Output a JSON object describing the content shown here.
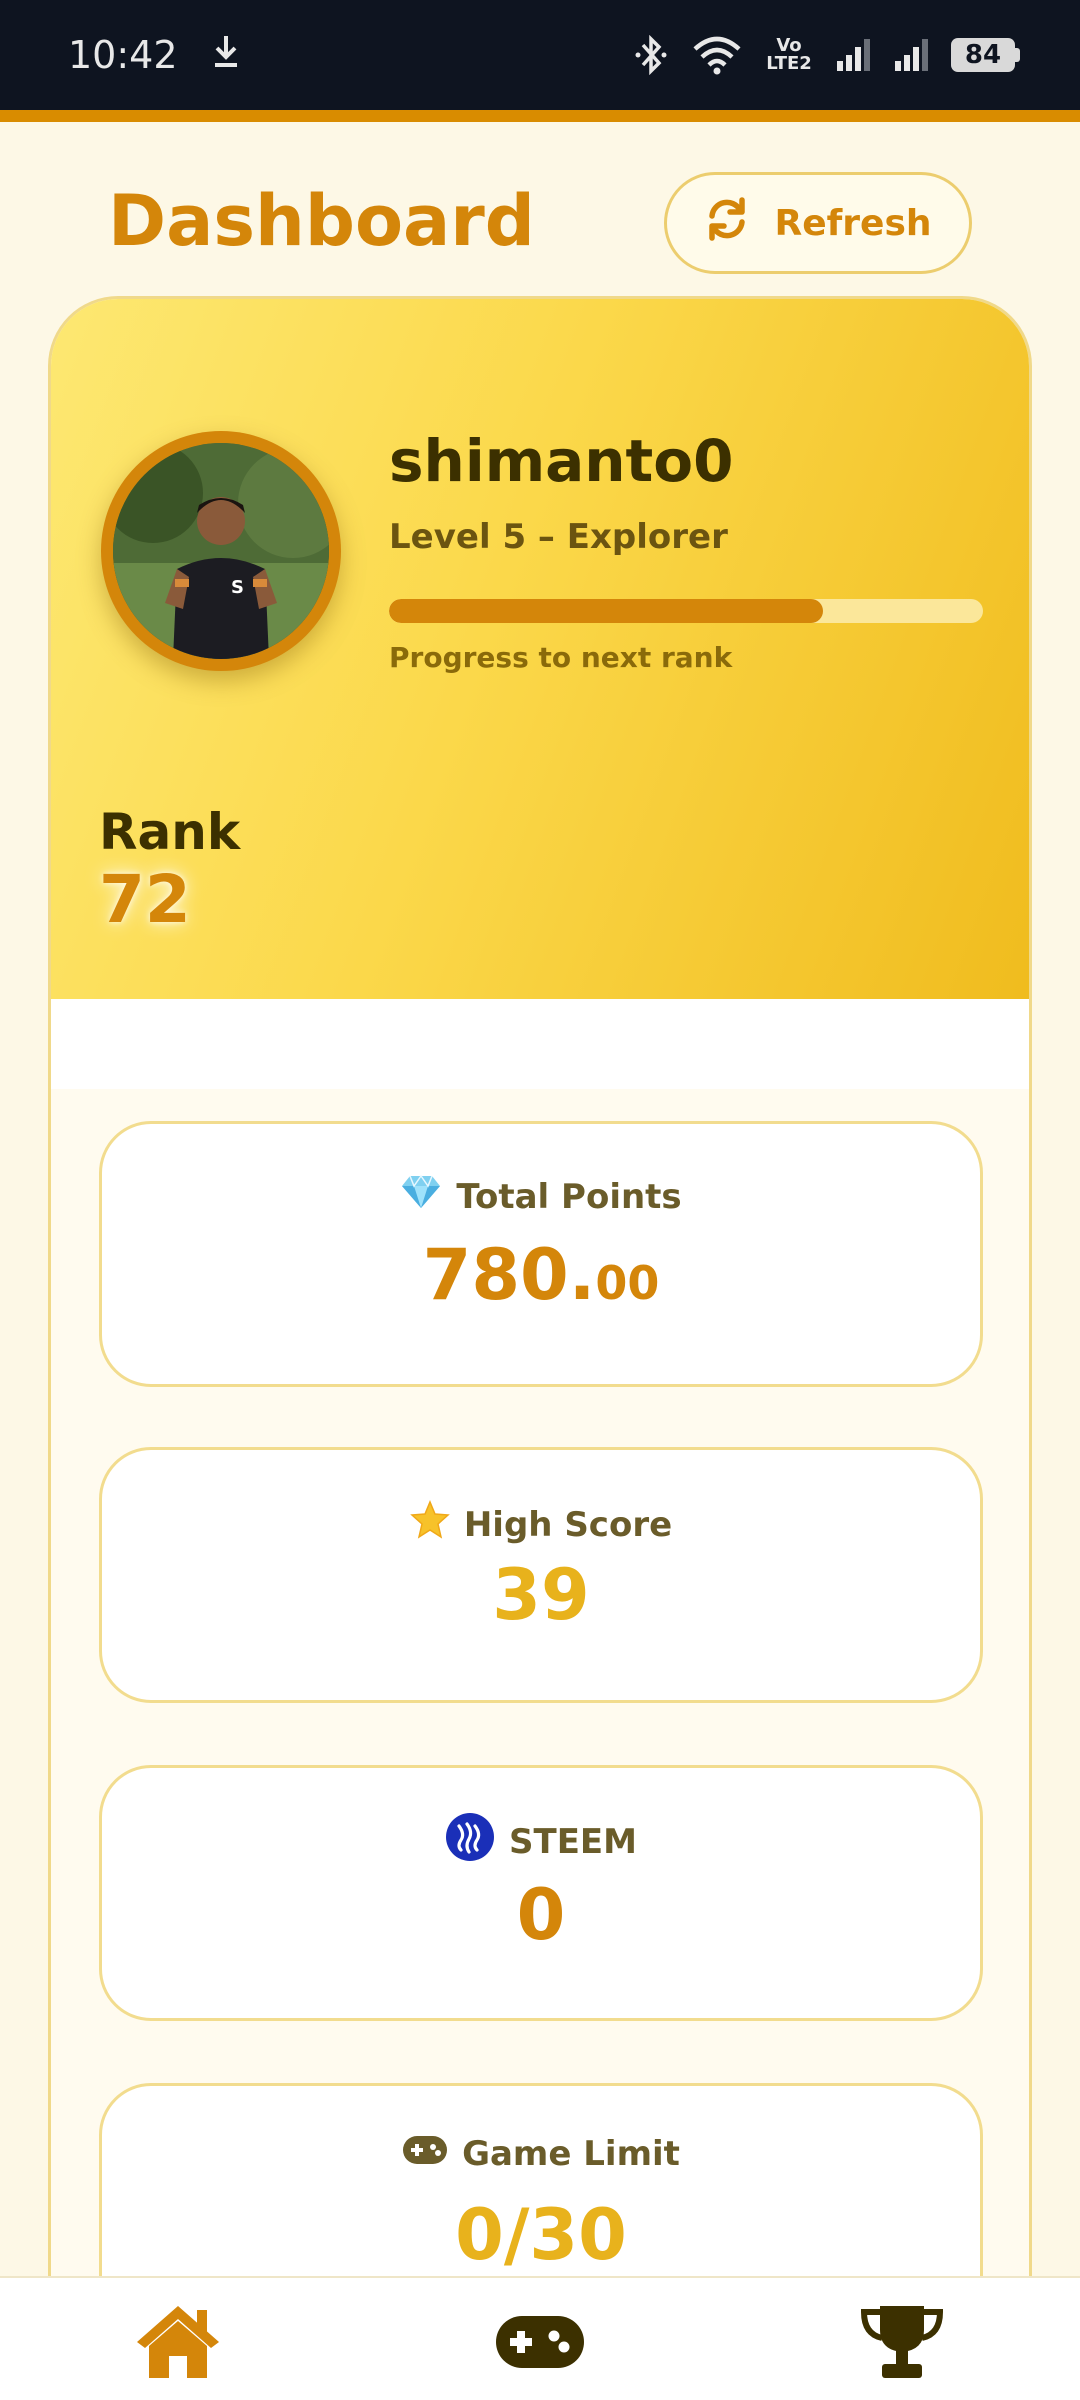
{
  "status_bar": {
    "time": "10:42",
    "network_label": "Vo LTE2",
    "battery": "84"
  },
  "header": {
    "title": "Dashboard",
    "refresh_label": "Refresh"
  },
  "profile": {
    "username": "shimanto0",
    "level": "Level 5 – Explorer",
    "progress_fraction": 0.73,
    "progress_caption": "Progress to next rank",
    "rank_label": "Rank",
    "rank_value": "72"
  },
  "stats": {
    "total_points": {
      "label": "Total Points",
      "value_main": "780.",
      "value_decimal": "00",
      "icon": "gem-icon"
    },
    "high_score": {
      "label": "High Score",
      "value": "39",
      "icon": "star-icon"
    },
    "steem": {
      "label": "STEEM",
      "value": "0",
      "icon": "steem-logo-icon"
    },
    "game_limit": {
      "label": "Game Limit",
      "value": "0/30",
      "icon": "gamepad-icon"
    }
  },
  "colors": {
    "accent": "#d4860a",
    "gold": "#e8b21c",
    "status_bar_bg": "#0e1420"
  },
  "bottom_nav": {
    "items": [
      "home-icon",
      "gamepad-icon",
      "trophy-icon"
    ],
    "active": "home-icon"
  }
}
